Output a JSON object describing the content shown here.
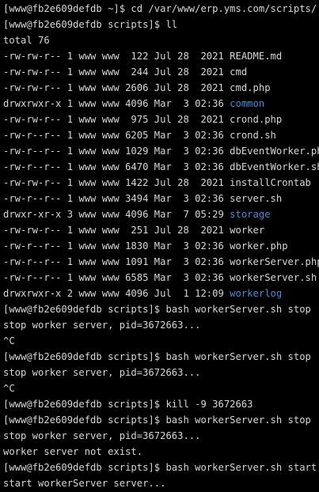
{
  "theme": {
    "background": "#000000",
    "foreground": "#d6d6d6",
    "directory_color": "#4b8ad6"
  },
  "terminal": {
    "lines": [
      {
        "type": "text",
        "text": "[www@fb2e609defdb ~]$ cd /var/www/erp.yms.com/scripts/"
      },
      {
        "type": "text",
        "text": "[www@fb2e609defdb scripts]$ ll"
      },
      {
        "type": "text",
        "text": "total 76"
      },
      {
        "type": "entry",
        "meta": "-rw-rw-r-- 1 www www  122 Jul 28  2021 ",
        "name": "README.md",
        "dir": false
      },
      {
        "type": "entry",
        "meta": "-rw-rw-r-- 1 www www  244 Jul 28  2021 ",
        "name": "cmd",
        "dir": false
      },
      {
        "type": "entry",
        "meta": "-rw-rw-r-- 1 www www 2606 Jul 28  2021 ",
        "name": "cmd.php",
        "dir": false
      },
      {
        "type": "entry",
        "meta": "drwxrwxr-x 1 www www 4096 Mar  3 02:36 ",
        "name": "common",
        "dir": true
      },
      {
        "type": "entry",
        "meta": "-rw-rw-r-- 1 www www  975 Jul 28  2021 ",
        "name": "crond.php",
        "dir": false
      },
      {
        "type": "entry",
        "meta": "-rw-r--r-- 1 www www 6205 Mar  3 02:36 ",
        "name": "crond.sh",
        "dir": false
      },
      {
        "type": "entry",
        "meta": "-rw-r--r-- 1 www www 1029 Mar  3 02:36 ",
        "name": "dbEventWorker.php",
        "dir": false
      },
      {
        "type": "entry",
        "meta": "-rw-r--r-- 1 www www 6470 Mar  3 02:36 ",
        "name": "dbEventWorker.sh",
        "dir": false
      },
      {
        "type": "entry",
        "meta": "-rw-rw-r-- 1 www www 1422 Jul 28  2021 ",
        "name": "installCrontab",
        "dir": false
      },
      {
        "type": "entry",
        "meta": "-rw-r--r-- 1 www www 3494 Mar  3 02:36 ",
        "name": "server.sh",
        "dir": false
      },
      {
        "type": "entry",
        "meta": "drwxr-xr-x 3 www www 4096 Mar  7 05:29 ",
        "name": "storage",
        "dir": true
      },
      {
        "type": "entry",
        "meta": "-rw-rw-r-- 1 www www  251 Jul 28  2021 ",
        "name": "worker",
        "dir": false
      },
      {
        "type": "entry",
        "meta": "-rw-r--r-- 1 www www 1830 Mar  3 02:36 ",
        "name": "worker.php",
        "dir": false
      },
      {
        "type": "entry",
        "meta": "-rw-r--r-- 1 www www 1091 Mar  3 02:36 ",
        "name": "workerServer.php",
        "dir": false
      },
      {
        "type": "entry",
        "meta": "-rw-r--r-- 1 www www 6585 Mar  3 02:36 ",
        "name": "workerServer.sh",
        "dir": false
      },
      {
        "type": "entry",
        "meta": "drwxrwxr-x 2 www www 4096 Jul  1 12:09 ",
        "name": "workerlog",
        "dir": true
      },
      {
        "type": "text",
        "text": "[www@fb2e609defdb scripts]$ bash workerServer.sh stop"
      },
      {
        "type": "text",
        "text": "stop worker server, pid=3672663..."
      },
      {
        "type": "text",
        "text": "^C"
      },
      {
        "type": "text",
        "text": "[www@fb2e609defdb scripts]$ bash workerServer.sh stop"
      },
      {
        "type": "text",
        "text": "stop worker server, pid=3672663..."
      },
      {
        "type": "text",
        "text": "^C"
      },
      {
        "type": "text",
        "text": "[www@fb2e609defdb scripts]$ kill -9 3672663"
      },
      {
        "type": "text",
        "text": "[www@fb2e609defdb scripts]$ bash workerServer.sh stop"
      },
      {
        "type": "text",
        "text": "stop worker server, pid=3672663..."
      },
      {
        "type": "text",
        "text": "worker server not exist."
      },
      {
        "type": "text",
        "text": "[www@fb2e609defdb scripts]$ bash workerServer.sh start"
      },
      {
        "type": "text",
        "text": "start workerServer server..."
      }
    ]
  }
}
